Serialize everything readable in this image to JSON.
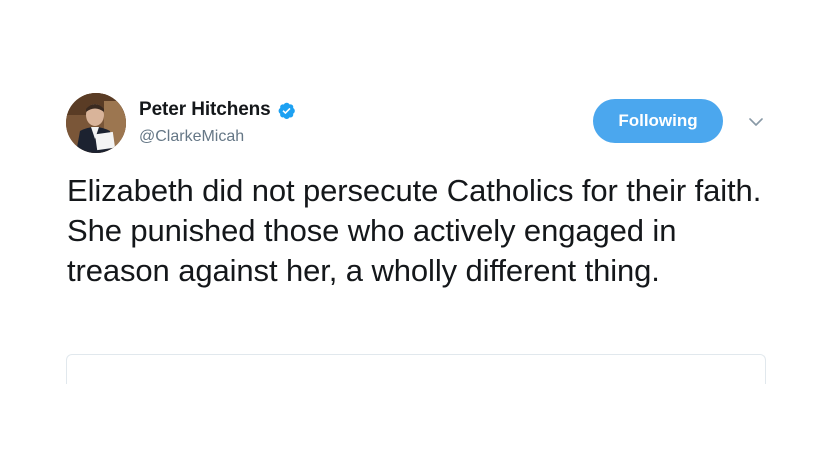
{
  "author": {
    "display_name": "Peter Hitchens",
    "handle": "@ClarkeMicah",
    "verified": true,
    "avatar_icon": "profile-photo"
  },
  "actions": {
    "follow_label": "Following",
    "menu_icon": "chevron-down-icon"
  },
  "tweet": {
    "text": "Elizabeth did not persecute Catholics for their faith. She punished those who actively engaged in treason against her, a wholly different thing."
  },
  "colors": {
    "accent": "#4ba7ee",
    "verified": "#1da1f2",
    "text": "#14171a",
    "secondary_text": "#657786",
    "border": "#e1e8ed"
  }
}
